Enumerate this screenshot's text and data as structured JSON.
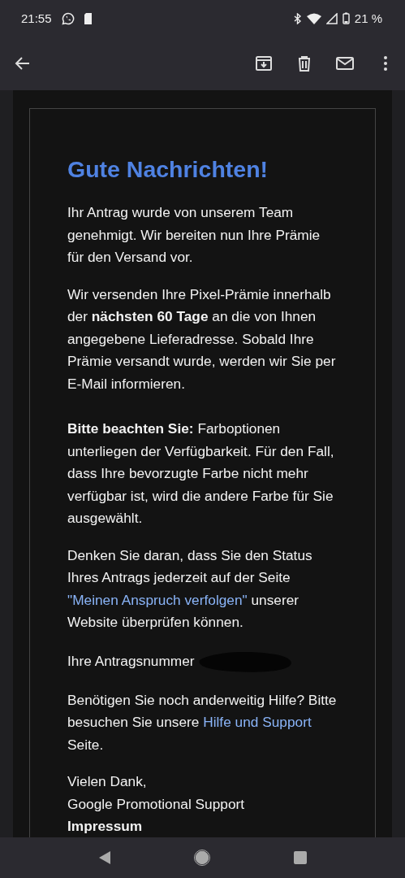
{
  "status_bar": {
    "time": "21:55",
    "battery": "21 %"
  },
  "email": {
    "heading": "Gute Nachrichten!",
    "paragraphs": [
      {
        "parts": [
          {
            "kind": "text",
            "text": "Ihr Antrag wurde von unserem Team genehmigt. Wir bereiten nun Ihre Prämie für den Versand vor."
          }
        ]
      },
      {
        "parts": [
          {
            "kind": "text",
            "text": "Wir versenden Ihre Pixel-Prämie innerhalb der **nächsten 60 Tage** an die von Ihnen angegebene Lieferadresse. Sobald Ihre Prämie versandt wurde, werden wir Sie per E-Mail informieren."
          }
        ]
      },
      {
        "parts": [
          {
            "kind": "text",
            "text": "**Bitte beachten Sie:** Farboptionen unterliegen der Verfügbarkeit. Für den Fall, dass Ihre bevorzugte Farbe nicht mehr verfügbar ist, wird die andere Farbe für Sie ausgewählt."
          }
        ],
        "extra_gap": true
      },
      {
        "parts": [
          {
            "kind": "text",
            "text": "Denken Sie daran, dass Sie den Status Ihres Antrags jederzeit auf der Seite "
          },
          {
            "kind": "link",
            "text": "\"Meinen Anspruch verfolgen\""
          },
          {
            "kind": "text",
            "text": " unserer Website überprüfen können."
          }
        ]
      },
      {
        "parts": [
          {
            "kind": "text",
            "text": "Ihre Antragsnummer"
          }
        ],
        "redacted": true
      },
      {
        "parts": [
          {
            "kind": "text",
            "text": "Benötigen Sie noch anderweitig Hilfe? Bitte besuchen Sie unsere "
          },
          {
            "kind": "link",
            "text": "Hilfe und Support"
          },
          {
            "kind": "text",
            "text": " Seite."
          }
        ]
      }
    ],
    "closing": [
      "Vielen Dank,",
      "Google Promotional Support"
    ],
    "footer": "Impressum"
  }
}
